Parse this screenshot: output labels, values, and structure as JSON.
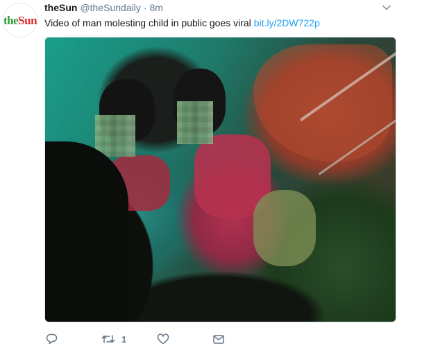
{
  "tweet": {
    "avatar_logo": {
      "part1": "the",
      "part2": "Sun"
    },
    "display_name": "theSun",
    "handle": "@theSundaily",
    "separator": "·",
    "time": "8m",
    "text": "Video of man molesting child in public goes viral",
    "link": "bit.ly/2DW722p"
  },
  "actions": {
    "retweet_count": "1"
  },
  "icons": {
    "caret": "chevron-down-icon",
    "reply": "reply-icon",
    "retweet": "retweet-icon",
    "like": "heart-icon",
    "dm": "envelope-icon"
  },
  "colors": {
    "link": "#1da1f2",
    "muted": "#657786",
    "text": "#14171a",
    "logo_green": "#2f9e3b",
    "logo_red": "#e02a2a"
  }
}
